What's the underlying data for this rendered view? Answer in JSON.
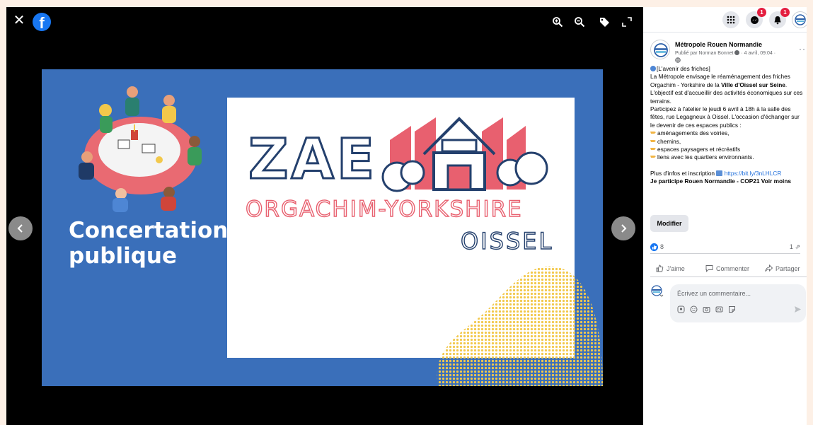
{
  "viewer": {
    "close_glyph": "✕",
    "brand_glyph": "f"
  },
  "slide": {
    "title_line1": "Concertation",
    "title_line2": "publique",
    "logo_title": "ZAE",
    "logo_subtitle": "ORGACHIM-YORKSHIRE",
    "logo_city": "OISSEL"
  },
  "topbar": {
    "messenger_badge": "1",
    "notifications_badge": "1"
  },
  "post": {
    "page_name": "Métropole Rouen Normandie",
    "published_by": "Publié par Norman Bonnet",
    "date": "· 4 avril, 09:04 ·",
    "more_glyph": "···",
    "intro": "[L'avenir des friches]",
    "line1_a": "La Métropole envisage le réaménagement des friches Orgachim - Yorkshire de la ",
    "line1_bold": "Ville d'Oissel sur Seine",
    "line1_end": ".",
    "line2": "L'objectif est d'accueillir des activités économiques sur ces terrains.",
    "line3": "Participez à l'atelier le jeudi 6 avril à 18h à la salle des fêtes, rue Legagneux à Oissel. L'occasion d'échanger sur le devenir de ces espaces publics :",
    "bullets": [
      "aménagements des voiries,",
      "chemins,",
      "espaces paysagers et récréatifs",
      "liens avec les quartiers environnants."
    ],
    "more_info": "Plus d'infos et inscription",
    "link": "https://bit.ly/3nLHLCR",
    "hashtags": "Je participe Rouen Normandie - COP21",
    "see_less": "Voir moins"
  },
  "edit_button": "Modifier",
  "reactions": {
    "count": "8",
    "shares": "1"
  },
  "actions": {
    "like": "J'aime",
    "comment": "Commenter",
    "share": "Partager"
  },
  "comment": {
    "placeholder": "Écrivez un commentaire..."
  },
  "colors": {
    "facebook_blue": "#1877f2",
    "slide_blue": "#3a6fba",
    "logo_navy": "#24406d",
    "logo_pink": "#e8606f",
    "dots_yellow": "#f2c84b"
  }
}
